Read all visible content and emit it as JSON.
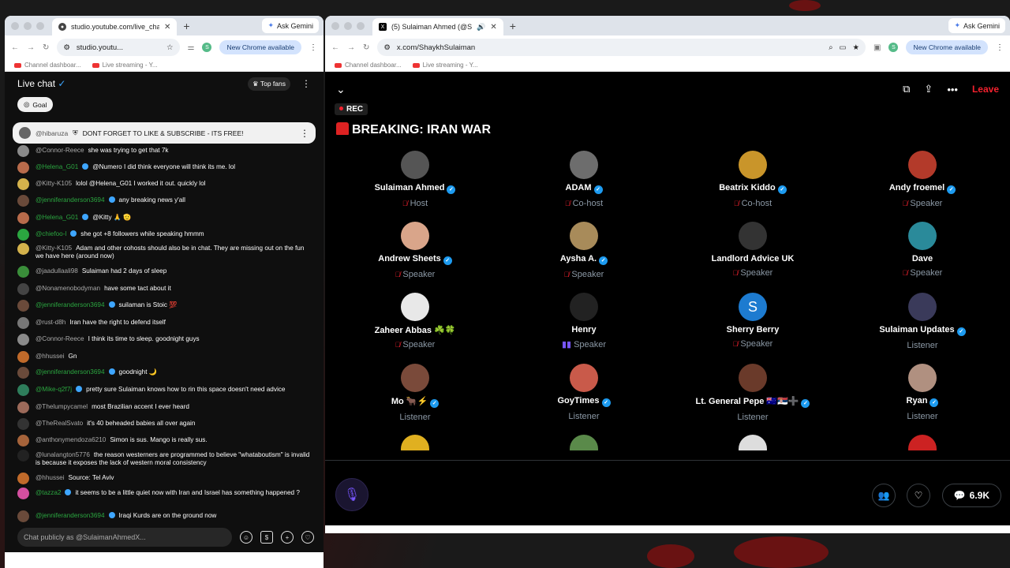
{
  "left": {
    "tab_title": "studio.youtube.com/live_chat",
    "url": "studio.youtu...",
    "new_chrome": "New Chrome available",
    "ask_gemini": "Ask Gemini",
    "bookmarks": [
      "Channel dashboar...",
      "Live streaming - Y..."
    ],
    "chat_title": "Live chat",
    "top_fans": "Top fans",
    "goal": "Goal",
    "pinned_user": "@hibaruza",
    "pinned_text": "DONT FORGET TO LIKE & SUBSCRIBE - ITS FREE!",
    "messages": [
      {
        "user": "@Connor-Reece",
        "text": "she was trying to get that 7k",
        "member": false,
        "color": "#8a8a8a"
      },
      {
        "user": "@Helena_G01",
        "text": "@Numero I did think everyone will think its me. lol",
        "member": true,
        "color": "#b86b4b"
      },
      {
        "user": "@Kitty-K105",
        "text": "lolol @Helena_G01 I worked it out. quickly lol",
        "member": false,
        "color": "#d4b24c"
      },
      {
        "user": "@jenniferanderson3694",
        "text": "any breaking news y'all",
        "member": true,
        "color": "#6a4a3a"
      },
      {
        "user": "@Helena_G01",
        "text": "@Kitty 🙏 🫡",
        "member": true,
        "color": "#b86b4b"
      },
      {
        "user": "@chiefoo-l",
        "text": "she got +8 followers while speaking hmmm",
        "member": true,
        "color": "#2ba640"
      },
      {
        "user": "@Kitty-K105",
        "text": "Adam and other cohosts should also be in chat. They are missing out on the fun we have here (around now)",
        "member": false,
        "color": "#d4b24c"
      },
      {
        "user": "@jaadullaali98",
        "text": "Sulaiman had 2 days of sleep",
        "member": false,
        "color": "#3a8e3a"
      },
      {
        "user": "@Nonamenobodyman",
        "text": "have some tact about it",
        "member": false,
        "color": "#444"
      },
      {
        "user": "@jenniferanderson3694",
        "text": "suilaman is Stoic 💯",
        "member": true,
        "color": "#6a4a3a"
      },
      {
        "user": "@rust-d8h",
        "text": "Iran have the right to defend itself",
        "member": false,
        "color": "#777"
      },
      {
        "user": "@Connor-Reece",
        "text": "I think its time to sleep. goodnight guys",
        "member": false,
        "color": "#8a8a8a"
      },
      {
        "user": "@hhussei",
        "text": "Gn",
        "member": false,
        "color": "#c06a2a"
      },
      {
        "user": "@jenniferanderson3694",
        "text": "goodnight 🌙",
        "member": true,
        "color": "#6a4a3a"
      },
      {
        "user": "@Mike-q2f7j",
        "text": "pretty sure Sulaiman knows how to rin this space doesn't need advice",
        "member": true,
        "color": "#2e7d5b"
      },
      {
        "user": "@Thelumpycamel",
        "text": "most Brazilian accent I ever heard",
        "member": false,
        "color": "#9c6a5a"
      },
      {
        "user": "@TheRealSvato",
        "text": "it's 40 beheaded babies all over again",
        "member": false,
        "color": "#333"
      },
      {
        "user": "@anthonymendoza6210",
        "text": "Simon is sus. Mango is really sus.",
        "member": false,
        "color": "#a5633a"
      },
      {
        "user": "@lunalangton5776",
        "text": "the reason westerners are programmed to believe \"whataboutism\" is invalid is because it exposes the lack of western moral consistency",
        "member": false,
        "color": "#222"
      },
      {
        "user": "@hhussei",
        "text": "Source: Tel Aviv",
        "member": false,
        "color": "#c06a2a"
      },
      {
        "user": "@tazza2",
        "text": "it seems to be a little quiet now with Iran and Israel has something happened ?",
        "member": true,
        "color": "#d44fa0"
      },
      {
        "user": "@jenniferanderson3694",
        "text": "Iraqi Kurds are on the ground now",
        "member": true,
        "color": "#6a4a3a"
      }
    ],
    "compose_placeholder": "Chat publicly as @SulaimanAhmedX..."
  },
  "right": {
    "tab_title": "(5) Sulaiman Ahmed (@S",
    "url": "x.com/ShaykhSulaiman",
    "new_chrome": "New Chrome available",
    "ask_gemini": "Ask Gemini",
    "bookmarks": [
      "Channel dashboar...",
      "Live streaming - Y..."
    ],
    "leave": "Leave",
    "rec": "REC",
    "space_title": "BREAKING: IRAN WAR",
    "participants": [
      {
        "name": "Sulaiman Ahmed",
        "role": "Host",
        "verified": true,
        "muted": true,
        "color": "#555"
      },
      {
        "name": "ADAM",
        "role": "Co-host",
        "verified": true,
        "muted": true,
        "color": "#6d6d6d"
      },
      {
        "name": "Beatrix Kiddo",
        "role": "Co-host",
        "verified": true,
        "muted": true,
        "color": "#c9952a"
      },
      {
        "name": "Andy froemel",
        "role": "Speaker",
        "verified": true,
        "muted": true,
        "color": "#b33a2a"
      },
      {
        "name": "Andrew Sheets",
        "role": "Speaker",
        "verified": true,
        "muted": true,
        "color": "#d9a58a"
      },
      {
        "name": "Aysha A.",
        "role": "Speaker",
        "verified": true,
        "muted": true,
        "color": "#a88b5a"
      },
      {
        "name": "Landlord Advice UK",
        "role": "Speaker",
        "verified": false,
        "muted": true,
        "color": "#333"
      },
      {
        "name": "Dave",
        "role": "Speaker",
        "verified": false,
        "muted": true,
        "color": "#2a8a9a"
      },
      {
        "name": "Zaheer Abbas ☘️🍀",
        "role": "Speaker",
        "verified": false,
        "muted": true,
        "color": "#e8e8e8"
      },
      {
        "name": "Henry",
        "role": "Speaker",
        "verified": false,
        "muted": false,
        "speaking": true,
        "color": "#222"
      },
      {
        "name": "Sherry Berry",
        "role": "Speaker",
        "verified": false,
        "muted": true,
        "color": "#1d7bd0",
        "initial": "S"
      },
      {
        "name": "Sulaiman Updates",
        "role": "Listener",
        "verified": true,
        "muted": false,
        "color": "#3a3a5a"
      },
      {
        "name": "Mo 🐂⚡",
        "role": "Listener",
        "verified": true,
        "muted": false,
        "color": "#7a4a3a"
      },
      {
        "name": "GoyTimes",
        "role": "Listener",
        "verified": true,
        "muted": false,
        "color": "#c95a4a"
      },
      {
        "name": "Lt. General Pepe 🇦🇺🇷🇸➕",
        "role": "Listener",
        "verified": true,
        "muted": false,
        "color": "#6a3a2a"
      },
      {
        "name": "Ryan",
        "role": "Listener",
        "verified": true,
        "muted": false,
        "color": "#b09080"
      },
      {
        "name": "",
        "role": "",
        "verified": false,
        "muted": false,
        "color": "#e0b020"
      },
      {
        "name": "",
        "role": "",
        "verified": false,
        "muted": false,
        "color": "#5a8a4a"
      },
      {
        "name": "",
        "role": "",
        "verified": false,
        "muted": false,
        "color": "#ddd"
      },
      {
        "name": "",
        "role": "",
        "verified": false,
        "muted": false,
        "color": "#c22"
      }
    ],
    "listener_count": "6.9K"
  }
}
